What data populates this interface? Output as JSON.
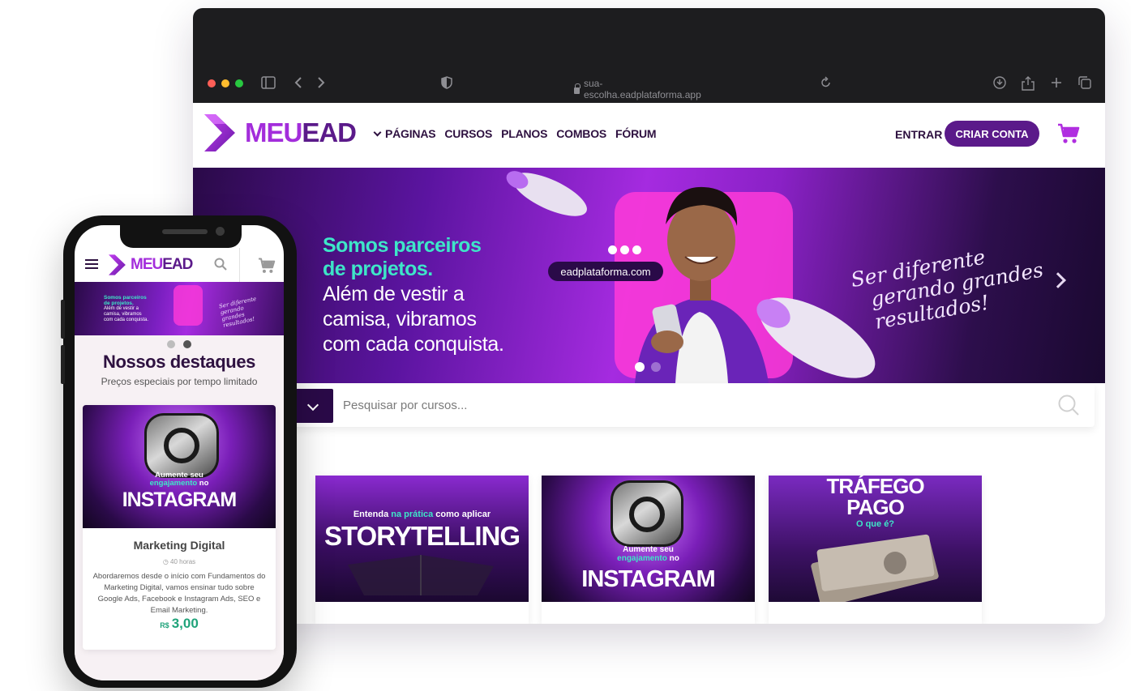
{
  "browser": {
    "address": "sua-escolha.eadplataforma.app",
    "traffic_lights": [
      "#ff5f57",
      "#febc2e",
      "#28c840"
    ]
  },
  "brand": {
    "name_part1": "MEU",
    "name_part2": "EAD",
    "colors": {
      "purple_light": "#a32ddb",
      "purple_dark": "#5b1a8a",
      "teal": "#3ee6c8",
      "price_green": "#1fa37a"
    }
  },
  "nav": {
    "items": [
      "PÁGINAS",
      "CURSOS",
      "PLANOS",
      "COMBOS",
      "FÓRUM"
    ],
    "login": "ENTRAR",
    "signup": "CRIAR CONTA",
    "cart_icon": "cart-icon"
  },
  "hero": {
    "headline_line1": "Somos parceiros",
    "headline_line2": "de projetos.",
    "sub_line1": "Além de vestir a",
    "sub_line2": "camisa, vibramos",
    "sub_line3": "com cada conquista.",
    "pill": "eadplataforma.com",
    "script_line1": "Ser diferente",
    "script_line2": "gerando grandes",
    "script_line3": "resultados!",
    "active_slide": 1,
    "slide_count": 2
  },
  "search": {
    "placeholder": "Pesquisar por cursos..."
  },
  "courses": [
    {
      "small_a": "Entenda ",
      "small_accent": "na prática",
      "small_b": " como aplicar",
      "big": "STORYTELLING"
    },
    {
      "small_a": "Aumente seu",
      "small_accent": "engajamento",
      "small_b": " no",
      "big": "INSTAGRAM"
    },
    {
      "big_top": "TRÁFEGO",
      "big_bottom": "PAGO",
      "small_accent": "O que é?"
    }
  ],
  "mobile": {
    "section_title": "Nossos destaques",
    "section_subtitle": "Preços especiais por tempo limitado",
    "card": {
      "thumb_small": "Aumente seu",
      "thumb_accent": "engajamento",
      "thumb_small_b": " no",
      "thumb_big": "INSTAGRAM",
      "title": "Marketing Digital",
      "duration": "40 horas",
      "description": "Abordaremos desde o início com Fundamentos do Marketing Digital, vamos ensinar tudo sobre Google Ads, Facebook e Instagram Ads, SEO e Email Marketing.",
      "currency": "R$",
      "price": "3,00"
    },
    "hero": {
      "t1_line1": "Somos parceiros",
      "t1_line2": "de projetos.",
      "t2_line1": "Além de vestir a",
      "t2_line2": "camisa, vibramos",
      "t2_line3": "com cada conquista.",
      "script": "Ser diferente gerando grandes resultados!"
    }
  }
}
